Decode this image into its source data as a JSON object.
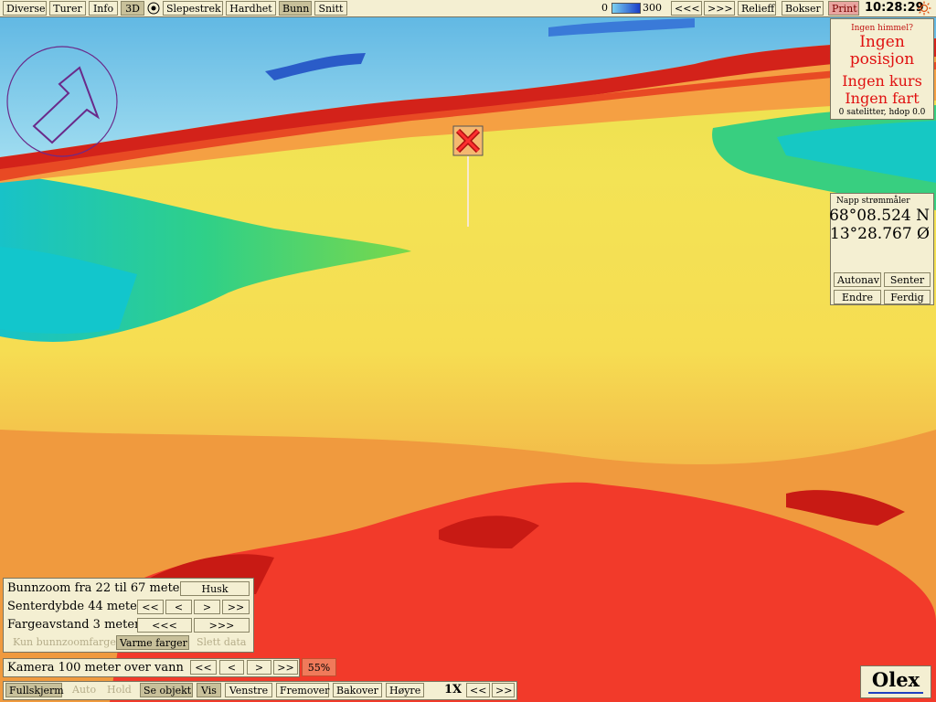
{
  "menu": {
    "items": [
      "Diverse",
      "Turer",
      "Info",
      "3D",
      "Slepestrek",
      "Hardhet",
      "Bunn",
      "Snitt"
    ],
    "depth_min": "0",
    "depth_max": "300",
    "nav_prev": "<<<",
    "nav_next": ">>>",
    "relief": "Relieff",
    "boxes": "Bokser",
    "print": "Print",
    "clock": "10:28:29"
  },
  "gps": {
    "note": "Ingen himmel?",
    "no_position": "Ingen posisjon",
    "no_course": "Ingen kurs",
    "no_speed": "Ingen fart",
    "satellites": "0 satelitter, hdop 0.0"
  },
  "position": {
    "title": "Napp strømmåler",
    "lat": "68°08.524 N",
    "lon": "13°28.767 Ø",
    "buttons": [
      "Autonav",
      "Senter",
      "Endre",
      "Ferdig"
    ]
  },
  "zoom_panel": {
    "bottom_zoom": "Bunnzoom fra 22 til 67 meter",
    "husk": "Husk",
    "center_depth": "Senterdybde 44 meter",
    "nav_small": [
      "<<",
      "<",
      ">",
      ">>"
    ],
    "color_distance": "Fargeavstand 3 meter",
    "nav_big": [
      "<<<",
      ">>>"
    ],
    "only_zoom_colors": "Kun bunnzoomfarger",
    "warm_colors": "Varme farger",
    "delete_data": "Slett data"
  },
  "camera": {
    "label": "Kamera 100 meter over vann",
    "nav": [
      "<<",
      "<",
      ">",
      ">>"
    ],
    "percent": "55%"
  },
  "bottombar": {
    "fullscreen": "Fullskjerm",
    "auto": "Auto",
    "hold": "Hold",
    "see_object": "Se objekt",
    "show": "Vis",
    "left": "Venstre",
    "forward": "Fremover",
    "backward": "Bakover",
    "right": "Høyre",
    "speed": "1X",
    "nav": [
      "<<",
      ">>"
    ]
  },
  "brand": "Olex",
  "colors": {
    "sea": "#6cc8e8",
    "deep_red": "#c21810",
    "red": "#f23a2a",
    "orange": "#f08a3a",
    "yellow": "#f2e04a",
    "green": "#40d070",
    "panel": "#f4efd2"
  }
}
